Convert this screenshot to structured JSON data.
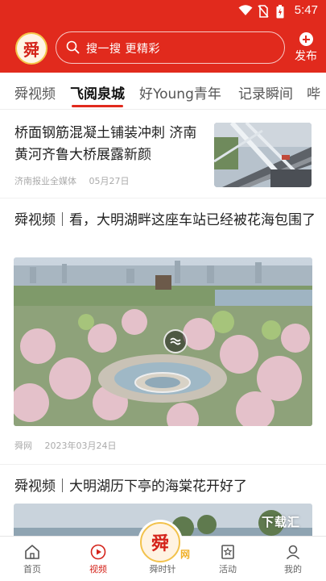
{
  "status_bar": {
    "time": "5:47",
    "icons": [
      "wifi-icon",
      "no-sim-icon",
      "battery-icon"
    ]
  },
  "header": {
    "logo_char": "舜",
    "search_placeholder": "搜一搜 更精彩",
    "publish_label": "发布"
  },
  "tabs": [
    {
      "label": "舜视频",
      "active": false
    },
    {
      "label": "飞阅泉城",
      "active": true
    },
    {
      "label": "好Young青年",
      "active": false
    },
    {
      "label": "记录瞬间",
      "active": false
    },
    {
      "label": "哔",
      "active": false
    }
  ],
  "feed": [
    {
      "title": "桥面钢筋混凝土铺装冲刺 济南黄河齐鲁大桥展露新颜",
      "source": "济南报业全媒体",
      "date": "05月27日"
    },
    {
      "title": "舜视频｜看，大明湖畔这座车站已经被花海包围了",
      "source": "舜网",
      "date": "2023年03月24日"
    },
    {
      "title": "舜视频｜大明湖历下亭的海棠花开好了",
      "watermark": "下载汇"
    }
  ],
  "bottom_nav": [
    {
      "label": "首页",
      "icon": "home-icon",
      "active": false
    },
    {
      "label": "视频",
      "icon": "video-play-icon",
      "active": true
    },
    {
      "label": "舜时针",
      "icon": "shun-logo-icon",
      "active": false
    },
    {
      "label": "活动",
      "icon": "star-bookmark-icon",
      "active": false
    },
    {
      "label": "我的",
      "icon": "user-icon",
      "active": false
    }
  ],
  "center_logo": {
    "char": "舜",
    "suffix": "网"
  },
  "colors": {
    "brand_red": "#e12a1d",
    "accent_gold": "#f2c24c"
  }
}
